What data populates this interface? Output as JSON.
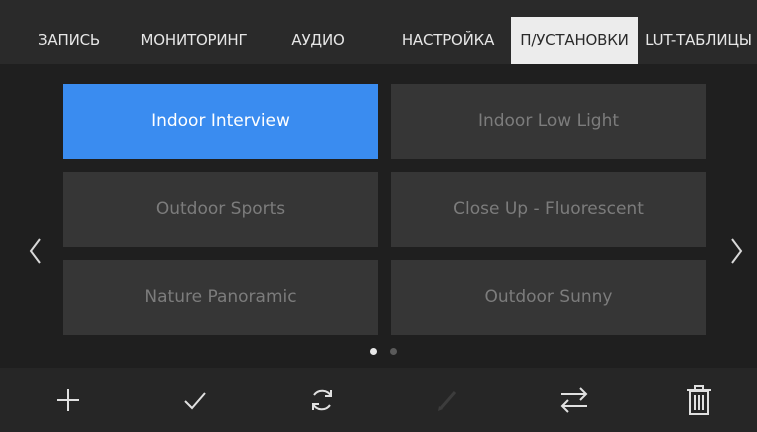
{
  "tabs": [
    {
      "label": "ЗАПИСЬ",
      "active": false
    },
    {
      "label": "МОНИТОРИНГ",
      "active": false
    },
    {
      "label": "АУДИО",
      "active": false
    },
    {
      "label": "НАСТРОЙКА",
      "active": false
    },
    {
      "label": "П/УСТАНОВКИ",
      "active": true
    },
    {
      "label": "LUT-ТАБЛИЦЫ",
      "active": false
    }
  ],
  "presets": [
    {
      "label": "Indoor Interview",
      "selected": true
    },
    {
      "label": "Indoor Low Light",
      "selected": false
    },
    {
      "label": "Outdoor Sports",
      "selected": false
    },
    {
      "label": "Close Up - Fluorescent",
      "selected": false
    },
    {
      "label": "Nature Panoramic",
      "selected": false
    },
    {
      "label": "Outdoor Sunny",
      "selected": false
    }
  ],
  "pagination": {
    "current_page": 1,
    "page_count": 2
  },
  "navigation": {
    "prev_icon": "chevron-left-icon",
    "next_icon": "chevron-right-icon"
  },
  "toolbar": [
    {
      "icon": "plus-icon",
      "enabled": true
    },
    {
      "icon": "check-icon",
      "enabled": true
    },
    {
      "icon": "refresh-icon",
      "enabled": true
    },
    {
      "icon": "pencil-icon",
      "enabled": false
    },
    {
      "icon": "swap-arrows-icon",
      "enabled": true
    },
    {
      "icon": "trash-icon",
      "enabled": true
    }
  ],
  "colors": {
    "accent": "#3a8cf0",
    "active_tab_bg": "#ececec",
    "preset_bg": "#363636",
    "preset_text": "#7c7c7c"
  }
}
